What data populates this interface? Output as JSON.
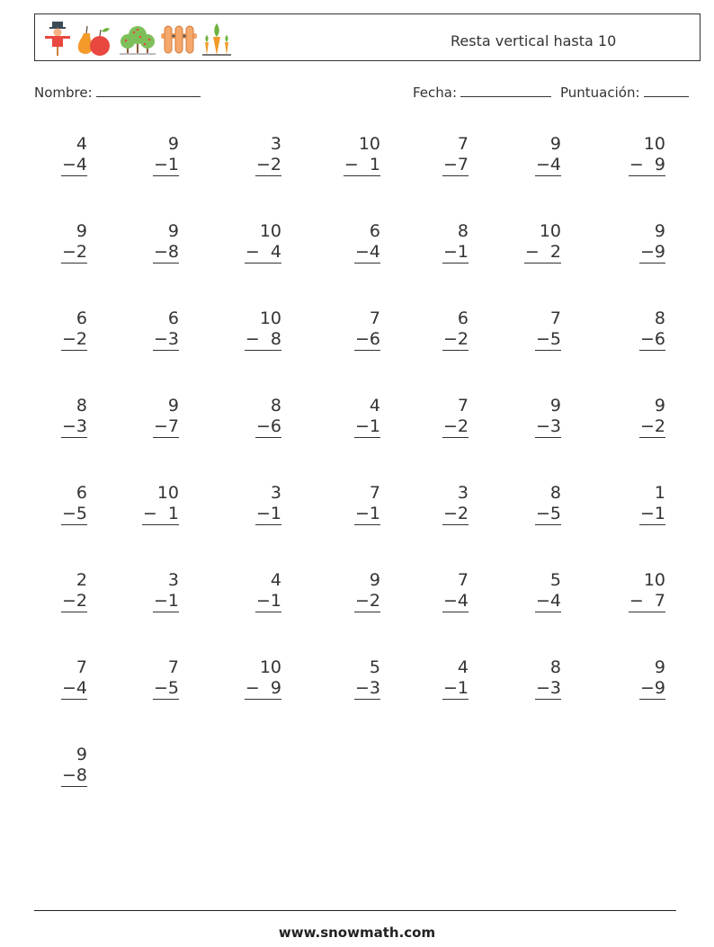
{
  "header": {
    "title": "Resta vertical hasta 10",
    "icons": [
      "scarecrow-icon",
      "pear-apple-icon",
      "fruit-trees-icon",
      "fence-icon",
      "carrots-icon"
    ]
  },
  "fields": {
    "name_label": "Nombre:",
    "date_label": "Fecha:",
    "score_label": "Puntuación:"
  },
  "problems": [
    {
      "top": "4",
      "bottom": "−4"
    },
    {
      "top": "9",
      "bottom": "−1"
    },
    {
      "top": "3",
      "bottom": "−2"
    },
    {
      "top": "10",
      "bottom": "−  1"
    },
    {
      "top": "7",
      "bottom": "−7"
    },
    {
      "top": "9",
      "bottom": "−4"
    },
    {
      "top": "10",
      "bottom": "−  9"
    },
    {
      "top": "9",
      "bottom": "−2"
    },
    {
      "top": "9",
      "bottom": "−8"
    },
    {
      "top": "10",
      "bottom": "−  4"
    },
    {
      "top": "6",
      "bottom": "−4"
    },
    {
      "top": "8",
      "bottom": "−1"
    },
    {
      "top": "10",
      "bottom": "−  2"
    },
    {
      "top": "9",
      "bottom": "−9"
    },
    {
      "top": "6",
      "bottom": "−2"
    },
    {
      "top": "6",
      "bottom": "−3"
    },
    {
      "top": "10",
      "bottom": "−  8"
    },
    {
      "top": "7",
      "bottom": "−6"
    },
    {
      "top": "6",
      "bottom": "−2"
    },
    {
      "top": "7",
      "bottom": "−5"
    },
    {
      "top": "8",
      "bottom": "−6"
    },
    {
      "top": "8",
      "bottom": "−3"
    },
    {
      "top": "9",
      "bottom": "−7"
    },
    {
      "top": "8",
      "bottom": "−6"
    },
    {
      "top": "4",
      "bottom": "−1"
    },
    {
      "top": "7",
      "bottom": "−2"
    },
    {
      "top": "9",
      "bottom": "−3"
    },
    {
      "top": "9",
      "bottom": "−2"
    },
    {
      "top": "6",
      "bottom": "−5"
    },
    {
      "top": "10",
      "bottom": "−  1"
    },
    {
      "top": "3",
      "bottom": "−1"
    },
    {
      "top": "7",
      "bottom": "−1"
    },
    {
      "top": "3",
      "bottom": "−2"
    },
    {
      "top": "8",
      "bottom": "−5"
    },
    {
      "top": "1",
      "bottom": "−1"
    },
    {
      "top": "2",
      "bottom": "−2"
    },
    {
      "top": "3",
      "bottom": "−1"
    },
    {
      "top": "4",
      "bottom": "−1"
    },
    {
      "top": "9",
      "bottom": "−2"
    },
    {
      "top": "7",
      "bottom": "−4"
    },
    {
      "top": "5",
      "bottom": "−4"
    },
    {
      "top": "10",
      "bottom": "−  7"
    },
    {
      "top": "7",
      "bottom": "−4"
    },
    {
      "top": "7",
      "bottom": "−5"
    },
    {
      "top": "10",
      "bottom": "−  9"
    },
    {
      "top": "5",
      "bottom": "−3"
    },
    {
      "top": "4",
      "bottom": "−1"
    },
    {
      "top": "8",
      "bottom": "−3"
    },
    {
      "top": "9",
      "bottom": "−9"
    },
    {
      "top": "9",
      "bottom": "−8"
    }
  ],
  "footer": {
    "website": "www.snowmath.com"
  }
}
